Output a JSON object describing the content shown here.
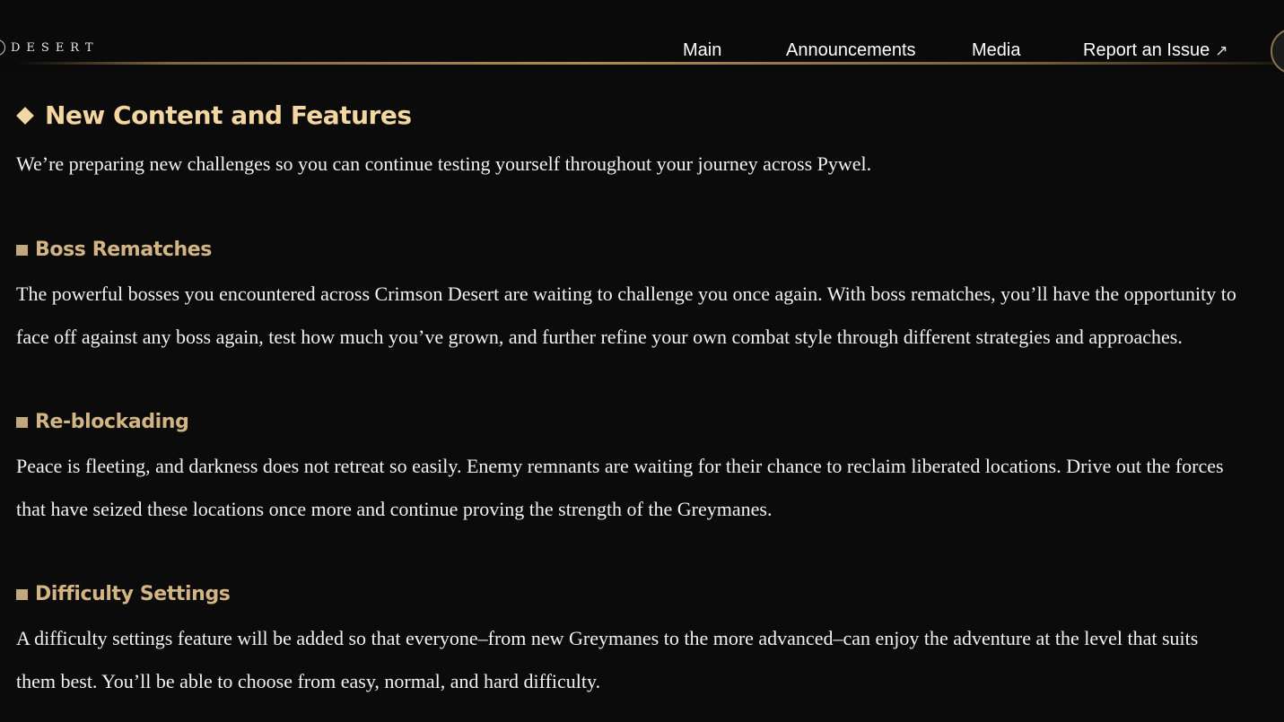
{
  "header": {
    "logo_text": "DESERT",
    "nav": [
      {
        "label": "Main"
      },
      {
        "label": "Announcements"
      },
      {
        "label": "Media"
      },
      {
        "label": "Report an Issue",
        "icon": "external-link-icon"
      }
    ],
    "accent_color": "#c3a77d"
  },
  "content": {
    "section_title": "New Content and Features",
    "intro": "We’re preparing new challenges so you can continue testing yourself throughout your journey across Pywel.",
    "subsections": [
      {
        "heading": "Boss Rematches",
        "lines": [
          "The powerful bosses you encountered across Crimson Desert are waiting to challenge you once again. With boss rematches, you’ll have the opportunity to",
          "face off against any boss again, test how much you’ve grown, and further refine your own combat style through different strategies and approaches."
        ]
      },
      {
        "heading": "Re-blockading",
        "lines": [
          "Peace is fleeting, and darkness does not retreat so easily. Enemy remnants are waiting for their chance to reclaim liberated locations. Drive out the forces",
          "that have seized these locations once more and continue proving the strength of the Greymanes."
        ]
      },
      {
        "heading": "Difficulty Settings",
        "lines": [
          "A difficulty settings feature will be added so that everyone–from new Greymanes to the more advanced–can enjoy the adventure at the level that suits",
          "them best. You’ll be able to choose from easy, normal, and hard difficulty."
        ]
      }
    ]
  }
}
